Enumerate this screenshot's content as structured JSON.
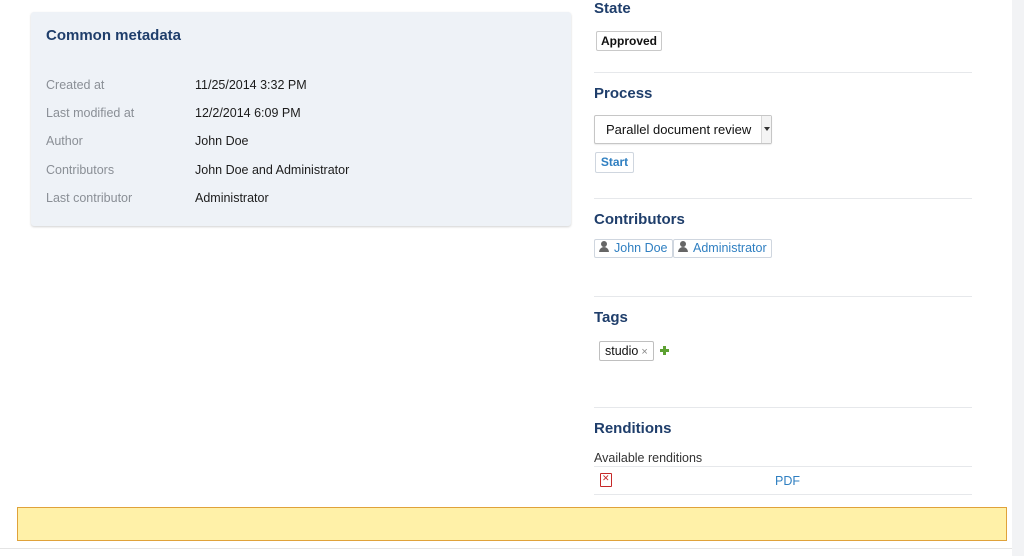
{
  "metadata": {
    "title": "Common metadata",
    "rows": [
      {
        "label": "Created at",
        "value": "11/25/2014 3:32 PM"
      },
      {
        "label": "Last modified at",
        "value": "12/2/2014 6:09 PM"
      },
      {
        "label": "Author",
        "value": "John Doe"
      },
      {
        "label": "Contributors",
        "value": "John Doe and Administrator"
      },
      {
        "label": "Last contributor",
        "value": "Administrator"
      }
    ]
  },
  "state": {
    "title": "State",
    "value": "Approved"
  },
  "process": {
    "title": "Process",
    "selected": "Parallel document review",
    "start_label": "Start"
  },
  "contributors": {
    "title": "Contributors",
    "items": [
      "John Doe",
      "Administrator"
    ]
  },
  "tags": {
    "title": "Tags",
    "items": [
      {
        "label": "studio",
        "remove": "×"
      }
    ]
  },
  "renditions": {
    "title": "Renditions",
    "available_label": "Available renditions",
    "items": [
      {
        "label": "PDF",
        "icon": "pdf-icon"
      }
    ]
  },
  "colors": {
    "heading": "#1f3e6b",
    "link": "#2f7fc1",
    "warning_bg": "#fff1a8",
    "warning_border": "#e0a23a"
  }
}
